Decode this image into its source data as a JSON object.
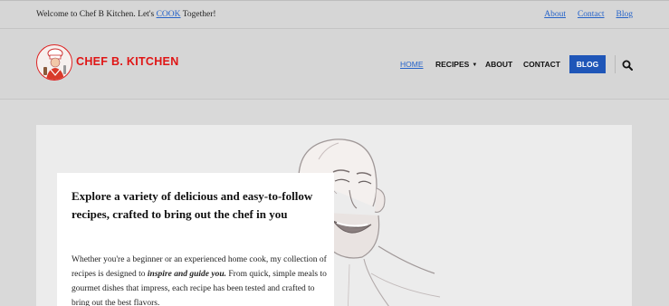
{
  "topbar": {
    "welcome_prefix": "Welcome to Chef B Kitchen. Let's",
    "welcome_link": "COOK",
    "welcome_suffix": "Together!",
    "links": [
      "About",
      "Contact",
      "Blog"
    ]
  },
  "header": {
    "brand": "CHEF B. KITCHEN",
    "nav": {
      "home": "HOME",
      "recipes": "RECIPES",
      "about": "ABOUT",
      "contact": "CONTACT",
      "blog": "BLOG"
    }
  },
  "hero": {
    "heading": "Explore a variety of delicious and easy-to-follow recipes, crafted to bring out the chef in you",
    "body_part1": "Whether you're a beginner or an experienced home cook, my collection of recipes is designed to",
    "body_emphasis": "inspire and guide you.",
    "body_part2": "From quick, simple meals to gourmet dishes that impress, each recipe has been tested and crafted to bring out the best flavors."
  },
  "colors": {
    "brand_red": "#e01515",
    "link_blue": "#2563c9",
    "button_blue": "#1f56b8"
  },
  "icons": [
    "chef-logo-icon",
    "caret-down-icon",
    "search-icon"
  ]
}
